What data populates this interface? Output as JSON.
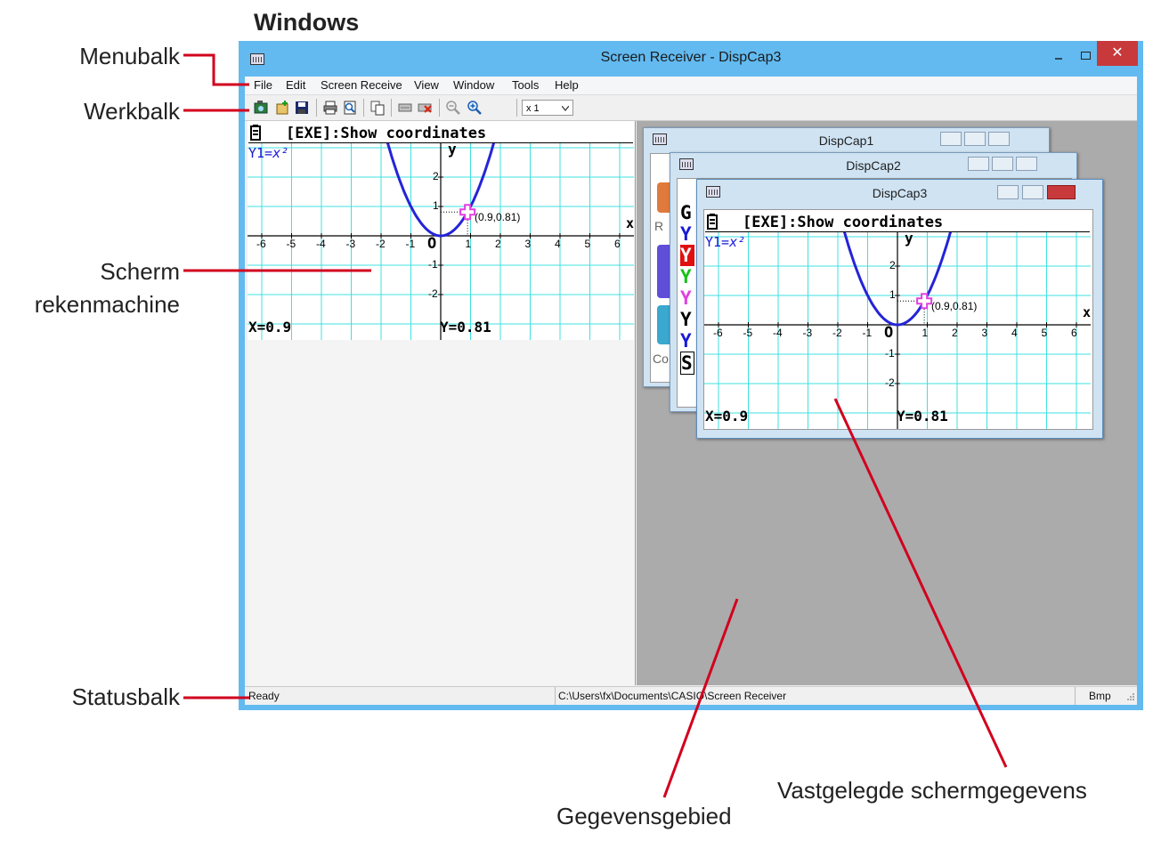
{
  "page": {
    "heading": "Windows"
  },
  "annotations": {
    "menubalk": "Menubalk",
    "werkbalk": "Werkbalk",
    "scherm_line1": "Scherm",
    "scherm_line2": "rekenmachine",
    "statusbalk": "Statusbalk",
    "vastgelegde": "Vastgelegde schermgegevens",
    "gegevensgebied": "Gegevensgebied"
  },
  "window": {
    "title": "Screen Receiver - DispCap3",
    "minimize": "–",
    "maximize": "□",
    "close": "✕"
  },
  "menu": [
    "File",
    "Edit",
    "Screen Receive",
    "View",
    "Window",
    "Tools",
    "Help"
  ],
  "toolbar": {
    "icons": [
      "capture-icon",
      "new-icon",
      "save-icon",
      "print-icon",
      "print-preview-icon",
      "copy-icon",
      "receive-icon",
      "stop-receive-icon",
      "zoom-out-icon",
      "zoom-in-icon"
    ],
    "zoom_value": "x 1"
  },
  "calculator": {
    "header": "[EXE]:Show coordinates",
    "equation_lhs": "Y1=",
    "equation_rhs": "x²",
    "x_axis_label": "x",
    "y_axis_label": "y",
    "origin": "O",
    "x_ticks": [
      "-6",
      "-5",
      "-4",
      "-3",
      "-2",
      "-1",
      "1",
      "2",
      "3",
      "4",
      "5",
      "6"
    ],
    "y_ticks": [
      "2",
      "1",
      "-1",
      "-2"
    ],
    "point_label": "(0.9,0.81)",
    "x_readout": "X=0.9",
    "y_readout": "Y=0.81"
  },
  "children": [
    {
      "title": "DispCap1",
      "peek": [
        "R",
        "Co"
      ]
    },
    {
      "title": "DispCap2",
      "peek": [
        "G",
        "Y",
        "Y",
        "Y",
        "Y",
        "Y",
        "Y",
        "S"
      ]
    },
    {
      "title": "DispCap3"
    }
  ],
  "statusbar": {
    "left": "Ready",
    "path": "C:\\Users\\fx\\Documents\\CASIO\\Screen Receiver",
    "format": "Bmp"
  },
  "colors": {
    "titlebar": "#62baf0",
    "close": "#c8393b",
    "grid": "#3fe0e0",
    "curve": "#2424d8",
    "cursor": "#e040e0",
    "annotation_line": "#d2001e"
  }
}
